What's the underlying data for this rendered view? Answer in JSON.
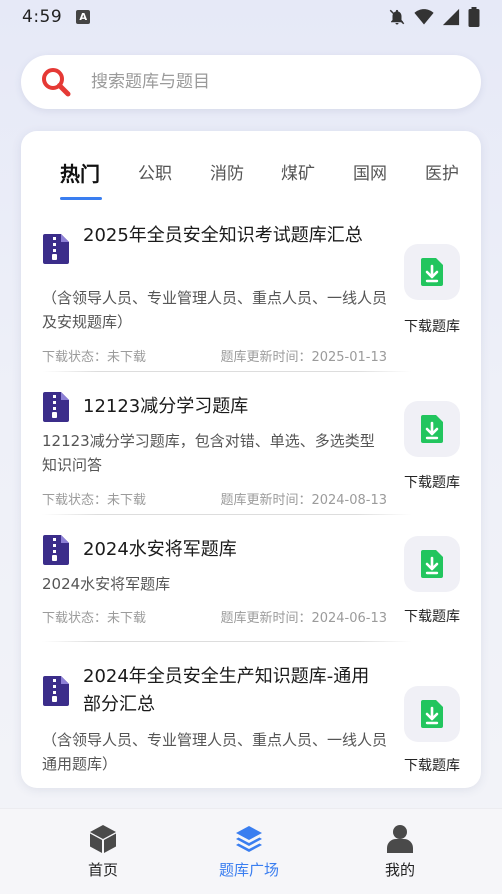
{
  "status_bar": {
    "time": "4:59"
  },
  "search": {
    "placeholder": "搜索题库与题目"
  },
  "tabs": [
    {
      "label": "热门",
      "active": true
    },
    {
      "label": "公职"
    },
    {
      "label": "消防"
    },
    {
      "label": "煤矿"
    },
    {
      "label": "国网"
    },
    {
      "label": "医护"
    }
  ],
  "items": [
    {
      "title": "2025年全员安全知识考试题库汇总",
      "desc": "（含领导人员、专业管理人员、重点人员、一线人员及安规题库）",
      "status": "下载状态：未下载",
      "updated": "题库更新时间：2025-01-13",
      "button": "下载题库"
    },
    {
      "title": "12123减分学习题库",
      "desc": "12123减分学习题库，包含对错、单选、多选类型知识问答",
      "status": "下载状态：未下载",
      "updated": "题库更新时间：2024-08-13",
      "button": "下载题库"
    },
    {
      "title": "2024水安将军题库",
      "desc": "2024水安将军题库",
      "status": "下载状态：未下载",
      "updated": "题库更新时间：2024-06-13",
      "button": "下载题库"
    },
    {
      "title": "2024年全员安全生产知识题库-通用部分汇总",
      "desc": "（含领导人员、专业管理人员、重点人员、一线人员通用题库）",
      "button": "下载题库"
    }
  ],
  "bottom_nav": [
    {
      "label": "首页",
      "icon": "cube-icon"
    },
    {
      "label": "题库广场",
      "icon": "layers-icon",
      "active": true
    },
    {
      "label": "我的",
      "icon": "user-icon"
    }
  ],
  "colors": {
    "accent": "#3a7ef0",
    "search_icon": "#e53935",
    "file_icon": "#3b2d8a",
    "download_green": "#22c55e"
  }
}
